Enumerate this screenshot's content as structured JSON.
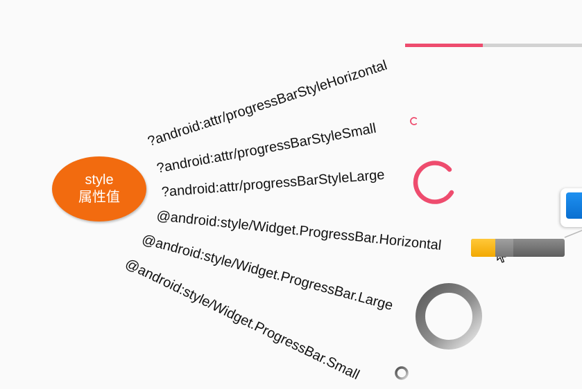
{
  "node": {
    "line1": "style",
    "line2": "属性值",
    "color": "#f26b0f"
  },
  "labels": [
    "?android:attr/progressBarStyleHorizontal",
    "?android:attr/progressBarStyleSmall",
    "?android:attr/progressBarStyleLarge",
    "@android:style/Widget.ProgressBar.Horizontal",
    "@android:style/Widget.ProgressBar.Large",
    "@android:style/Widget.ProgressBar.Small"
  ],
  "previews": {
    "material_horizontal": {
      "progress": 0.43,
      "accent": "#ee4c6e",
      "track": "#d2d2d2"
    },
    "material_small": {
      "accent": "#ee4c6e"
    },
    "material_large": {
      "accent": "#ee4c6e"
    },
    "holo_horizontal": {
      "progress": 0.26,
      "secondary_progress": 0.45,
      "primary_color": "#f2a800",
      "track_color": "#6e6e6e"
    },
    "classic_large": {
      "color": "#7a7a7a"
    },
    "classic_small": {
      "color": "#7a7a7a"
    }
  },
  "icons": [
    "mouse-cursor-icon"
  ]
}
